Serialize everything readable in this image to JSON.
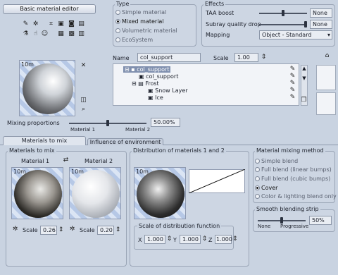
{
  "header": {
    "title_button": "Basic material editor"
  },
  "type_group": {
    "title": "Type",
    "options": [
      {
        "label": "Simple material",
        "selected": false
      },
      {
        "label": "Mixed material",
        "selected": true
      },
      {
        "label": "Volumetric material",
        "selected": false
      },
      {
        "label": "EcoSystem",
        "selected": false
      }
    ]
  },
  "effects_group": {
    "title": "Effects",
    "taa_boost_label": "TAA boost",
    "taa_boost_value": "None",
    "subray_label": "Subray quality drop",
    "subray_value": "None",
    "mapping_label": "Mapping",
    "mapping_value": "Object - Standard"
  },
  "name_row": {
    "name_label": "Name",
    "name_value": "col_support",
    "scale_label": "Scale",
    "scale_value": "1.00"
  },
  "preview": {
    "distance_label": "10m"
  },
  "tree": {
    "items": [
      {
        "label": "col_support"
      },
      {
        "label": "col_support"
      },
      {
        "label": "Frost"
      },
      {
        "label": "Snow Layer"
      },
      {
        "label": "Ice"
      }
    ]
  },
  "mixing": {
    "label": "Mixing proportions",
    "value": "50.00%",
    "level_fraction": 0.5,
    "material1_label": "Material 1",
    "material2_label": "Material 2"
  },
  "tabs": [
    {
      "label": "Materials to mix",
      "active": true
    },
    {
      "label": "Influence of environment",
      "active": false
    }
  ],
  "materials_to_mix": {
    "title": "Materials to mix",
    "material1_title": "Material 1",
    "material2_title": "Material 2",
    "preview1_distance": "10m",
    "preview2_distance": "10m",
    "scale1_label": "Scale",
    "scale1_value": "0.26",
    "scale2_label": "Scale",
    "scale2_value": "0.20"
  },
  "distribution": {
    "title": "Distribution of materials 1 and 2",
    "preview_distance": "10m",
    "scale_title": "Scale of distribution function",
    "x_label": "X",
    "x_value": "1.000",
    "y_label": "Y",
    "y_value": "1.000",
    "z_label": "Z",
    "z_value": "1.000"
  },
  "mixing_method": {
    "title": "Material mixing method",
    "options": [
      {
        "label": "Simple blend",
        "selected": false
      },
      {
        "label": "Full blend (linear bumps)",
        "selected": false
      },
      {
        "label": "Full blend (cubic bumps)",
        "selected": false
      },
      {
        "label": "Cover",
        "selected": true
      },
      {
        "label": "Color & lighting blend only",
        "selected": false
      }
    ]
  },
  "smooth_strip": {
    "title": "Smooth blending strip",
    "value": "50%",
    "level_fraction": 0.5,
    "min_label": "None",
    "max_label": "Progressive"
  },
  "colors": {
    "background": "#c9d3e1",
    "field": "#e9edf3",
    "highlight": "#f2f4f8"
  }
}
